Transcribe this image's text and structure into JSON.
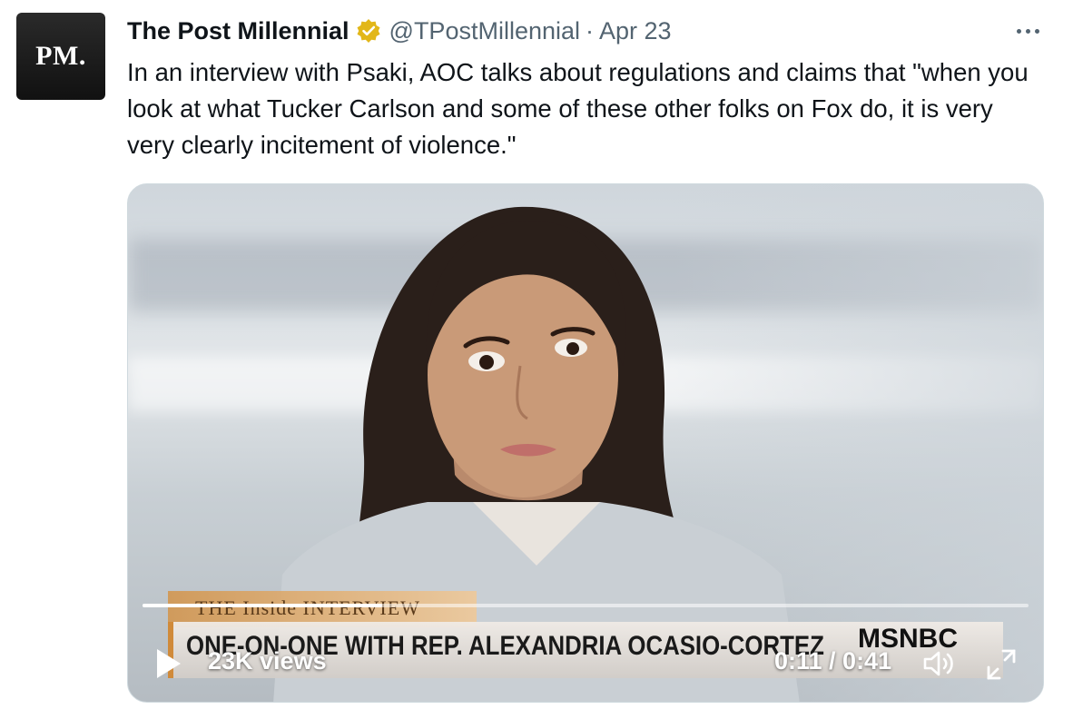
{
  "tweet": {
    "avatar_text": "PM.",
    "display_name": "The Post Millennial",
    "handle": "@TPostMillennial",
    "separator": "·",
    "date": "Apr 23",
    "text": "In an interview with Psaki, AOC talks about regulations and claims that \"when you look at what Tucker Carlson and some of these other folks on Fox do, it is very very clearly incitement of violence.\""
  },
  "video": {
    "lower_third_tag": "THE Inside INTERVIEW",
    "headline": "ONE-ON-ONE WITH REP. ALEXANDRIA OCASIO-CORTEZ",
    "network": "MSNBC",
    "views": "23K views",
    "time": "0:11 / 0:41",
    "progress_fraction": 0.27
  },
  "colors": {
    "text_primary": "#0f1419",
    "text_secondary": "#536471",
    "verified_gold": "#e2b719"
  },
  "icons": {
    "verified": "verified-badge-icon",
    "more": "more-options-icon",
    "play": "play-icon",
    "volume": "volume-icon",
    "fullscreen": "fullscreen-icon"
  }
}
